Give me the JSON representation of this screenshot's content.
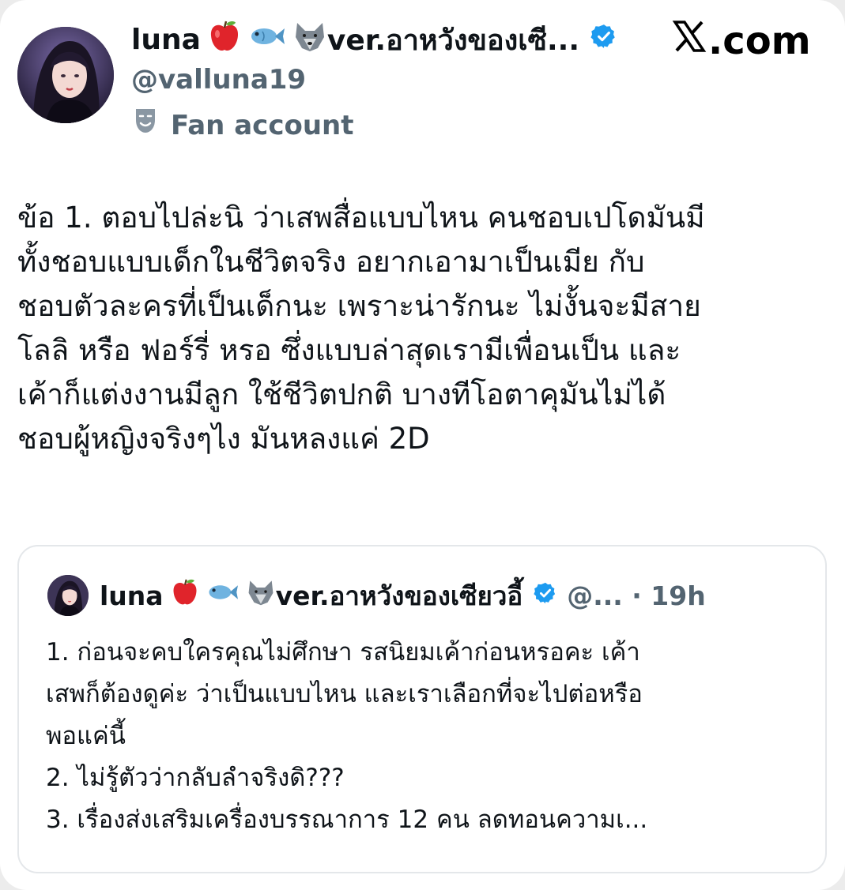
{
  "tweet": {
    "display_name": "luna",
    "name_suffix": "ver.อาหวังของเซี...",
    "handle": "@valluna19",
    "label": "Fan account",
    "source": ".com",
    "body_lines": [
      "ข้อ 1. ตอบไปล่ะนิ ว่าเสพสื่อแบบไหน คนชอบเปโดมันมี",
      "ทั้งชอบแบบเด็กในชีวิตจริง อยากเอามาเป็นเมีย กับ",
      "ชอบตัวละครที่เป็นเด็กนะ เพราะน่ารักนะ ไม่งั้นจะมีสาย",
      "โลลิ หรือ ฟอร์รี่ หรอ ซึ่งแบบล่าสุดเรามีเพื่อนเป็น และ",
      "เค้าก็แต่งงานมีลูก ใช้ชีวิตปกติ บางทีโอตาคุมันไม่ได้",
      "ชอบผู้หญิงจริงๆไง มันหลงแค่ 2D"
    ]
  },
  "quoted": {
    "display_name": "luna",
    "name_suffix": "ver.อาหวังของเซียวอี้",
    "meta": "@... · 19h",
    "body_lines": [
      "1. ก่อนจะคบใครคุณไม่ศึกษา รสนิยมเค้าก่อนหรอคะ เค้า",
      "เสพก็ต้องดูค่ะ ว่าเป็นแบบไหน และเราเลือกที่จะไปต่อหรือ",
      "พอแค่นี้",
      "2. ไม่รู้ตัวว่ากลับลำจริงดิ???",
      "3. เรื่องส่งเสริมเครื่องบรรณาการ 12 คน ลดทอนความเ..."
    ]
  },
  "icons": {
    "verified": "verified-badge-icon",
    "apple": "red-apple-emoji",
    "fish": "fish-emoji",
    "wolf": "wolf-emoji",
    "mask": "performing-arts-mask-icon",
    "x": "x-logo-icon"
  },
  "colors": {
    "verified": "#1d9bf0",
    "secondary_text": "#536471",
    "border": "#e4e7ea"
  }
}
